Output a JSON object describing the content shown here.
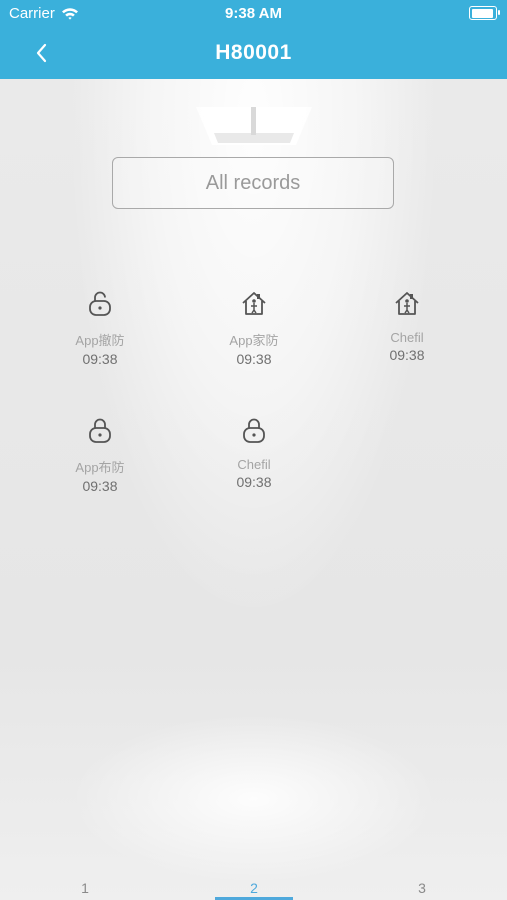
{
  "status_bar": {
    "carrier": "Carrier",
    "time": "9:38 AM"
  },
  "nav": {
    "title": "H80001",
    "back_icon": "chevron-left-icon"
  },
  "filter": {
    "label": "All records"
  },
  "records": [
    {
      "icon": "lock-open-icon",
      "label": "App撤防",
      "time": "09:38"
    },
    {
      "icon": "home-person-icon",
      "label": "App家防",
      "time": "09:38"
    },
    {
      "icon": "home-person-icon",
      "label": "Chefil",
      "time": "09:38"
    },
    {
      "icon": "lock-closed-icon",
      "label": "App布防",
      "time": "09:38"
    },
    {
      "icon": "lock-closed-icon",
      "label": "Chefil",
      "time": "09:38"
    }
  ],
  "pager": {
    "pages": [
      "1",
      "2",
      "3"
    ],
    "active": "2"
  },
  "colors": {
    "accent": "#3ab0db",
    "indicator": "#4fa9dc"
  }
}
